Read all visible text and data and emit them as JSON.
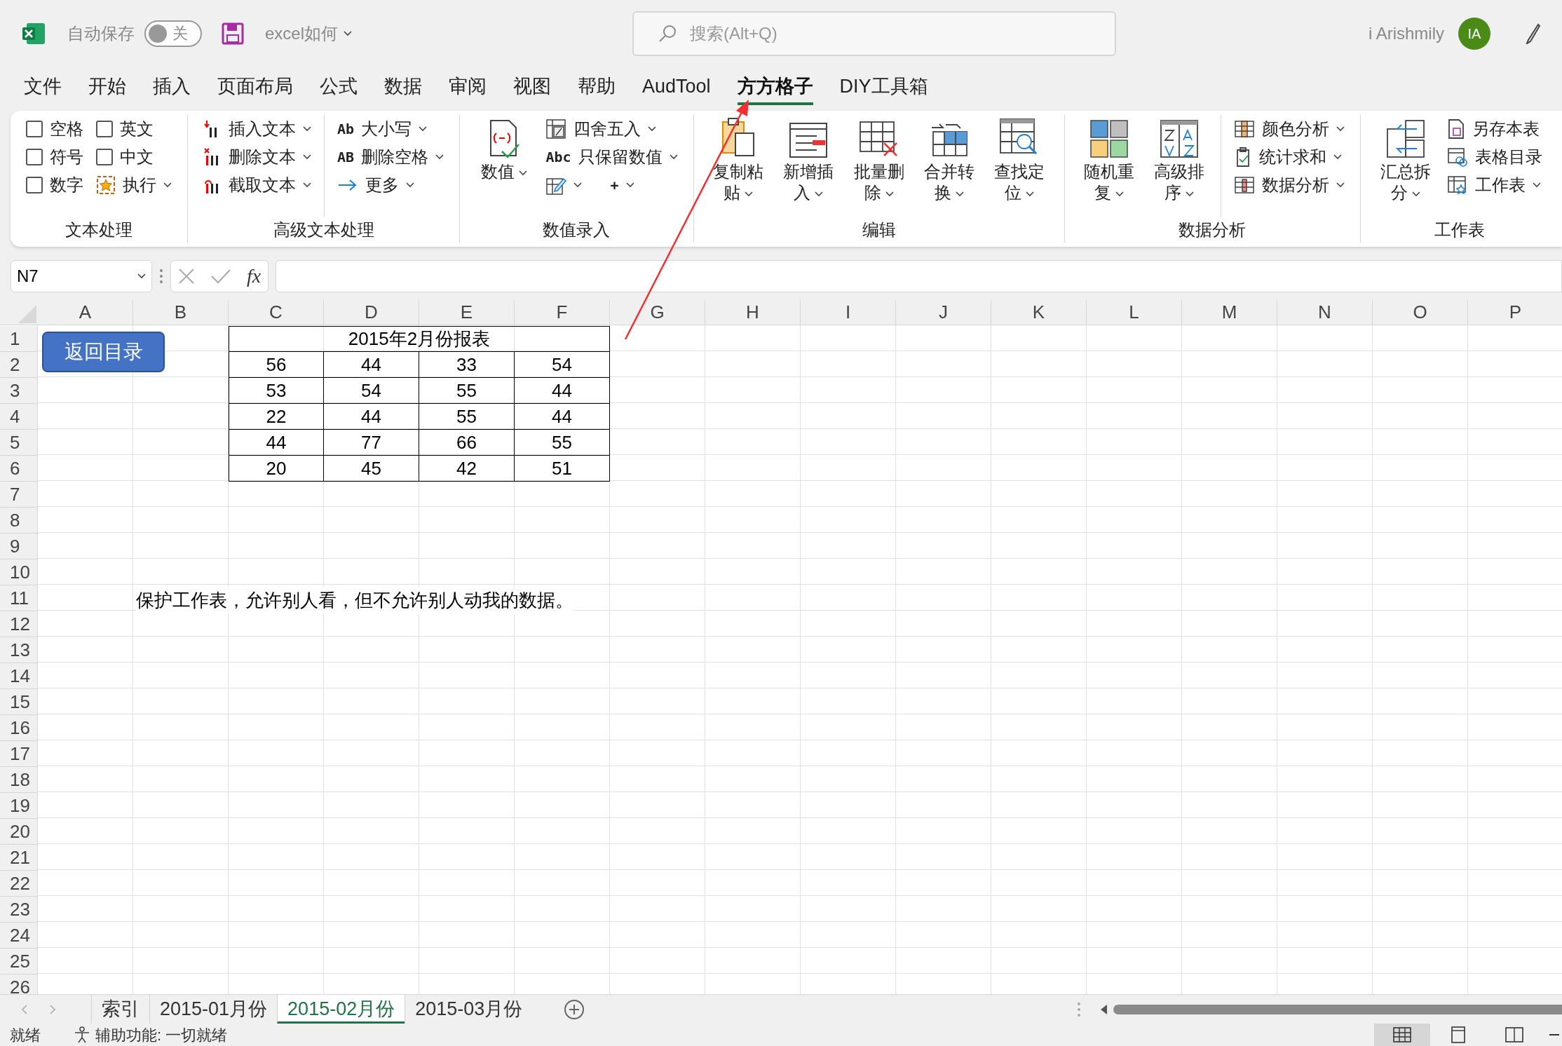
{
  "title_bar": {
    "autosave_label": "自动保存",
    "autosave": {
      "on": false,
      "label": "关"
    },
    "file_name": "excel如何",
    "search": {
      "placeholder": "搜索(Alt+Q)"
    },
    "user_name": "i Arishmily",
    "avatar_initials": "IA"
  },
  "menu_tabs": [
    {
      "label": "文件",
      "selected": false
    },
    {
      "label": "开始",
      "selected": false
    },
    {
      "label": "插入",
      "selected": false
    },
    {
      "label": "页面布局",
      "selected": false
    },
    {
      "label": "公式",
      "selected": false
    },
    {
      "label": "数据",
      "selected": false
    },
    {
      "label": "审阅",
      "selected": false
    },
    {
      "label": "视图",
      "selected": false
    },
    {
      "label": "帮助",
      "selected": false
    },
    {
      "label": "AudTool",
      "selected": false
    },
    {
      "label": "方方格子",
      "selected": true
    },
    {
      "label": "DIY工具箱",
      "selected": false
    }
  ],
  "ribbon": {
    "groups": [
      {
        "title": "文本处理",
        "columns": [
          {
            "separator_before": false,
            "items": [
              {
                "kind": "checkbox",
                "label": "空格",
                "checked": false
              },
              {
                "kind": "checkbox",
                "label": "符号",
                "checked": false
              },
              {
                "kind": "checkbox",
                "label": "数字",
                "checked": false
              }
            ]
          },
          {
            "separator_before": false,
            "items": [
              {
                "kind": "checkbox",
                "label": "英文",
                "checked": false
              },
              {
                "kind": "checkbox",
                "label": "中文",
                "checked": false
              },
              {
                "kind": "small",
                "label": "执行",
                "dropdown": true
              }
            ]
          }
        ]
      },
      {
        "title": "高级文本处理",
        "columns": [
          {
            "separator_before": false,
            "items": [
              {
                "kind": "small",
                "label": "插入文本",
                "dropdown": true
              },
              {
                "kind": "small",
                "label": "删除文本",
                "dropdown": true
              },
              {
                "kind": "small",
                "label": "截取文本",
                "dropdown": true
              }
            ]
          },
          {
            "separator_before": true,
            "items": [
              {
                "kind": "small",
                "glyph": "Ab",
                "label": "大小写",
                "dropdown": true
              },
              {
                "kind": "small",
                "glyph": "AB",
                "label": "删除空格",
                "dropdown": true
              },
              {
                "kind": "small",
                "label": "更多",
                "dropdown": true
              }
            ]
          }
        ]
      },
      {
        "title": "数值录入",
        "columns": [
          {
            "separator_before": false,
            "items": [
              {
                "kind": "large",
                "label": "数值",
                "dropdown": true
              }
            ]
          },
          {
            "separator_before": false,
            "items": [
              {
                "kind": "small",
                "label": "四舍五入",
                "dropdown": true
              },
              {
                "kind": "small",
                "glyph": "Abc",
                "label": "只保留数值",
                "dropdown": true
              },
              {
                "kind": "pair",
                "items": [
                  {
                    "kind": "small",
                    "dropdown": true
                  },
                  {
                    "kind": "small",
                    "glyph": "+",
                    "dropdown": true
                  }
                ]
              }
            ]
          }
        ]
      },
      {
        "title": "编辑",
        "columns": [
          {
            "separator_before": false,
            "items": [
              {
                "kind": "large",
                "label": "复制粘贴",
                "dropdown": true
              }
            ]
          },
          {
            "separator_before": false,
            "items": [
              {
                "kind": "large",
                "label": "新增插入",
                "dropdown": true
              }
            ]
          },
          {
            "separator_before": false,
            "items": [
              {
                "kind": "large",
                "label": "批量删除",
                "dropdown": true
              }
            ]
          },
          {
            "separator_before": false,
            "items": [
              {
                "kind": "large",
                "label": "合并转换",
                "dropdown": true
              }
            ]
          },
          {
            "separator_before": false,
            "items": [
              {
                "kind": "large",
                "label": "查找定位",
                "dropdown": true
              }
            ]
          }
        ]
      },
      {
        "title": "数据分析",
        "columns": [
          {
            "separator_before": false,
            "items": [
              {
                "kind": "large",
                "label": "随机重复",
                "dropdown": true
              }
            ]
          },
          {
            "separator_before": false,
            "items": [
              {
                "kind": "large",
                "label": "高级排序",
                "dropdown": true
              }
            ]
          },
          {
            "separator_before": true,
            "items": [
              {
                "kind": "small",
                "label": "颜色分析",
                "dropdown": true
              },
              {
                "kind": "small",
                "label": "统计求和",
                "dropdown": true
              },
              {
                "kind": "small",
                "label": "数据分析",
                "dropdown": true
              }
            ]
          }
        ]
      },
      {
        "title": "工作表",
        "columns": [
          {
            "separator_before": false,
            "items": [
              {
                "kind": "large",
                "label": "汇总拆分",
                "dropdown": true
              }
            ]
          },
          {
            "separator_before": false,
            "items": [
              {
                "kind": "small",
                "label": "另存本表",
                "dropdown": false
              },
              {
                "kind": "small",
                "label": "表格目录",
                "dropdown": false
              },
              {
                "kind": "small",
                "label": "工作表",
                "dropdown": true
              }
            ]
          }
        ]
      }
    ]
  },
  "formula_bar": {
    "name_box": "N7",
    "fx": "fx"
  },
  "sheet": {
    "columns": [
      "A",
      "B",
      "C",
      "D",
      "E",
      "F",
      "G",
      "H",
      "I",
      "J",
      "K",
      "L",
      "M",
      "N",
      "O",
      "P"
    ],
    "rows": [
      "1",
      "2",
      "3",
      "4",
      "5",
      "6",
      "7",
      "8",
      "9",
      "10",
      "11",
      "12",
      "13",
      "14",
      "15",
      "16",
      "17",
      "18",
      "19",
      "20",
      "21",
      "22",
      "23",
      "24",
      "25",
      "26"
    ],
    "button": "返回目录",
    "table_title": "2015年2月份报表",
    "table": [
      [
        "56",
        "44",
        "33",
        "54"
      ],
      [
        "53",
        "54",
        "55",
        "44"
      ],
      [
        "22",
        "44",
        "55",
        "44"
      ],
      [
        "44",
        "77",
        "66",
        "55"
      ],
      [
        "20",
        "45",
        "42",
        "51"
      ]
    ],
    "note": "保护工作表，允许别人看，但不允许别人动我的数据。"
  },
  "sheet_tabs": [
    {
      "label": "索引",
      "selected": false
    },
    {
      "label": "2015-01月份",
      "selected": false
    },
    {
      "label": "2015-02月份",
      "selected": true
    },
    {
      "label": "2015-03月份",
      "selected": false
    }
  ],
  "status_bar": {
    "status": "就绪",
    "accessibility": "辅助功能: 一切就绪",
    "views": [
      {
        "selected": true
      },
      {
        "selected": false
      },
      {
        "selected": false
      }
    ]
  }
}
